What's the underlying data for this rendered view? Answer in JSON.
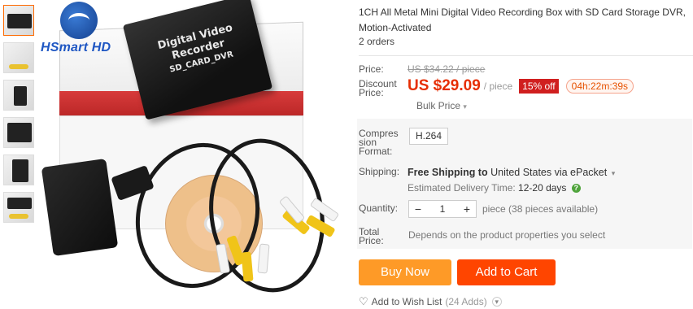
{
  "product": {
    "title": "1CH All Metal Mini Digital Video Recording Box with SD Card Storage DVR, Motion-Activated",
    "orders": "2 orders"
  },
  "image": {
    "logo_text": "HSmart HD",
    "device_label_line1": "Digital Video Recorder",
    "device_label_line2": "SD_CARD_DVR",
    "thumbnails": [
      "thumb-1",
      "thumb-2",
      "thumb-3",
      "thumb-4",
      "thumb-5",
      "thumb-6"
    ]
  },
  "pricing": {
    "price_label": "Price:",
    "original_price": "US $34.22 / piece",
    "discount_label_line1": "Discount",
    "discount_label_line2": "Price:",
    "discount_price": "US $29.09",
    "per_unit": "/ piece",
    "discount_badge": "15% off",
    "timer": "04h:22m:39s",
    "bulk_price": "Bulk Price",
    "bulk_caret": "▾"
  },
  "specs": {
    "compression_label_line1": "Compres",
    "compression_label_line2": "sion",
    "compression_label_line3": "Format:",
    "compression_value": "H.264"
  },
  "shipping": {
    "label": "Shipping:",
    "free_text": "Free Shipping to",
    "destination": "United States via ePacket",
    "caret": "▾",
    "delivery_label": "Estimated Delivery Time:",
    "delivery_days": "12-20 days",
    "help": "?"
  },
  "quantity": {
    "label": "Quantity:",
    "minus": "−",
    "value": "1",
    "plus": "+",
    "available": "piece (38 pieces available)"
  },
  "total": {
    "label_line1": "Total",
    "label_line2": "Price:",
    "description": "Depends on the product properties you select"
  },
  "actions": {
    "buy_now": "Buy Now",
    "add_to_cart": "Add to Cart",
    "wishlist_icon": "♡",
    "wishlist": "Add to Wish List",
    "wishlist_count": "(24 Adds)",
    "wishlist_caret": "▾"
  },
  "colors": {
    "accent_orange": "#fe9a27",
    "cart_red": "#ff4500",
    "price_red": "#e62e04",
    "badge_red": "#d01f1f"
  }
}
